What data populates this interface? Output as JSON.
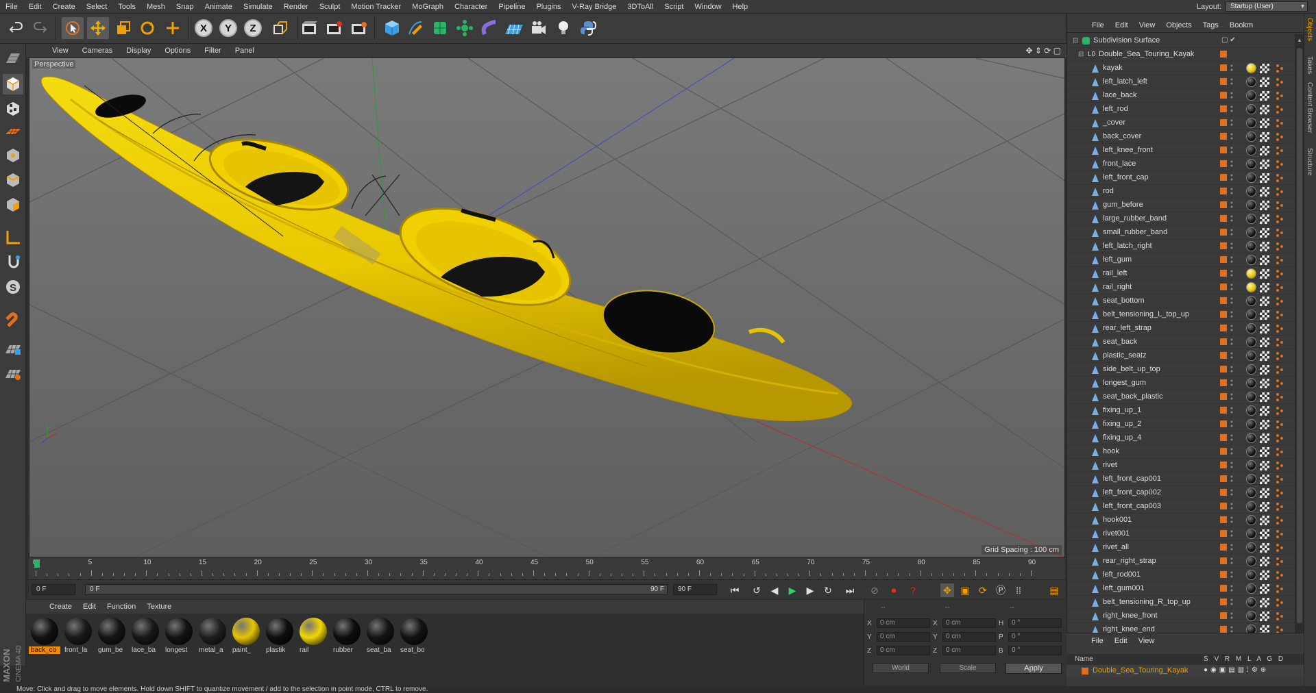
{
  "menubar": {
    "items": [
      "File",
      "Edit",
      "Create",
      "Select",
      "Tools",
      "Mesh",
      "Snap",
      "Animate",
      "Simulate",
      "Render",
      "Sculpt",
      "Motion Tracker",
      "MoGraph",
      "Character",
      "Pipeline",
      "Plugins",
      "V-Ray Bridge",
      "3DToAll",
      "Script",
      "Window",
      "Help"
    ],
    "layout_label": "Layout:",
    "layout_value": "Startup (User)"
  },
  "toolbar": {
    "axis_x": "X",
    "axis_y": "Y",
    "axis_z": "Z",
    "icons": [
      "undo-icon",
      "redo-icon",
      "select-icon",
      "move-icon",
      "scale-icon",
      "rotate-icon",
      "add-icon",
      "x-axis-icon",
      "y-axis-icon",
      "z-axis-icon",
      "coordinate-system-icon",
      "render-view-icon",
      "render-picture-viewer-icon",
      "render-settings-icon",
      "cube-icon",
      "pen-icon",
      "subdivision-icon",
      "array-icon",
      "deformer-icon",
      "floor-icon",
      "camera-icon",
      "light-icon",
      "python-icon"
    ]
  },
  "viewport": {
    "menu": [
      "View",
      "Cameras",
      "Display",
      "Options",
      "Filter",
      "Panel"
    ],
    "label": "Perspective",
    "grid_spacing": "Grid Spacing : 100 cm",
    "background": "#6f6f6f",
    "kayak_color": "#f5d000"
  },
  "timeline": {
    "ticks": [
      "0",
      "5",
      "10",
      "15",
      "20",
      "25",
      "30",
      "35",
      "40",
      "45",
      "50",
      "55",
      "60",
      "65",
      "70",
      "75",
      "80",
      "85",
      "90"
    ],
    "current_frame": "0 F"
  },
  "transport": {
    "start_field": "0 F",
    "range_start": "0 F",
    "range_end": "90 F",
    "end_field": "90 F"
  },
  "materials": {
    "menu": [
      "Create",
      "Edit",
      "Function",
      "Texture"
    ],
    "items": [
      {
        "name": "back_co",
        "color": "#111111",
        "selected": true
      },
      {
        "name": "front_la",
        "color": "#1a1a1a",
        "selected": false
      },
      {
        "name": "gum_be",
        "color": "#151515",
        "selected": false
      },
      {
        "name": "lace_ba",
        "color": "#181818",
        "selected": false
      },
      {
        "name": "longest",
        "color": "#131313",
        "selected": false
      },
      {
        "name": "metal_a",
        "color": "#202020",
        "selected": false
      },
      {
        "name": "paint_",
        "color": "#e6c400",
        "selected": false
      },
      {
        "name": "plastik",
        "color": "#0e0e0e",
        "selected": false
      },
      {
        "name": "rail",
        "color": "#f2d800",
        "selected": false
      },
      {
        "name": "rubber",
        "color": "#0d0d0d",
        "selected": false
      },
      {
        "name": "seat_ba",
        "color": "#141414",
        "selected": false
      },
      {
        "name": "seat_bo",
        "color": "#121212",
        "selected": false
      }
    ],
    "brand": "MAXON CINEMA 4D"
  },
  "coords": {
    "header": [
      "--",
      "--",
      "--"
    ],
    "rows": [
      {
        "a": "X",
        "av": "0 cm",
        "b": "X",
        "bv": "0 cm",
        "c": "H",
        "cv": "0 °"
      },
      {
        "a": "Y",
        "av": "0 cm",
        "b": "Y",
        "bv": "0 cm",
        "c": "P",
        "cv": "0 °"
      },
      {
        "a": "Z",
        "av": "0 cm",
        "b": "Z",
        "bv": "0 cm",
        "c": "B",
        "cv": "0 °"
      }
    ],
    "world": "World",
    "scale": "Scale",
    "apply": "Apply"
  },
  "status": "Move: Click and drag to move elements. Hold down SHIFT to quantize movement / add to the selection in point mode, CTRL to remove.",
  "objects": {
    "menu": [
      "File",
      "Edit",
      "View",
      "Objects",
      "Tags",
      "Bookm"
    ],
    "root": "Subdivision Surface",
    "group": "Double_Sea_Touring_Kayak",
    "items": [
      {
        "name": "kayak",
        "tag": "yellow"
      },
      {
        "name": "left_latch_left",
        "tag": "black"
      },
      {
        "name": "lace_back",
        "tag": "black"
      },
      {
        "name": "left_rod",
        "tag": "black"
      },
      {
        "name": "_cover",
        "tag": "black"
      },
      {
        "name": "back_cover",
        "tag": "black"
      },
      {
        "name": "left_knee_front",
        "tag": "black"
      },
      {
        "name": "front_lace",
        "tag": "black"
      },
      {
        "name": "left_front_cap",
        "tag": "black"
      },
      {
        "name": "rod",
        "tag": "black"
      },
      {
        "name": "gum_before",
        "tag": "black"
      },
      {
        "name": "large_rubber_band",
        "tag": "black"
      },
      {
        "name": "small_rubber_band",
        "tag": "black"
      },
      {
        "name": "left_latch_right",
        "tag": "black"
      },
      {
        "name": "left_gum",
        "tag": "black"
      },
      {
        "name": "rail_left",
        "tag": "yellow"
      },
      {
        "name": "rail_right",
        "tag": "yellow"
      },
      {
        "name": "seat_bottom",
        "tag": "black"
      },
      {
        "name": "belt_tensioning_L_top_up",
        "tag": "black"
      },
      {
        "name": "rear_left_strap",
        "tag": "black"
      },
      {
        "name": "seat_back",
        "tag": "black"
      },
      {
        "name": "plastic_seatz",
        "tag": "black"
      },
      {
        "name": "side_belt_up_top",
        "tag": "black"
      },
      {
        "name": "longest_gum",
        "tag": "black"
      },
      {
        "name": "seat_back_plastic",
        "tag": "black"
      },
      {
        "name": "fixing_up_1",
        "tag": "black"
      },
      {
        "name": "fixing_up_2",
        "tag": "black"
      },
      {
        "name": "fixing_up_4",
        "tag": "black"
      },
      {
        "name": "hook",
        "tag": "black"
      },
      {
        "name": "rivet",
        "tag": "black"
      },
      {
        "name": "left_front_cap001",
        "tag": "black"
      },
      {
        "name": "left_front_cap002",
        "tag": "black"
      },
      {
        "name": "left_front_cap003",
        "tag": "black"
      },
      {
        "name": "hook001",
        "tag": "black"
      },
      {
        "name": "rivet001",
        "tag": "black"
      },
      {
        "name": "rivet_all",
        "tag": "black"
      },
      {
        "name": "rear_right_strap",
        "tag": "black"
      },
      {
        "name": "left_rod001",
        "tag": "black"
      },
      {
        "name": "left_gum001",
        "tag": "black"
      },
      {
        "name": "belt_tensioning_R_top_up",
        "tag": "black"
      },
      {
        "name": "right_knee_front",
        "tag": "black"
      },
      {
        "name": "right_knee_end",
        "tag": "black"
      }
    ]
  },
  "side_tabs": [
    "Objects",
    "Takes",
    "Content Browser",
    "Structure"
  ],
  "layers": {
    "menu": [
      "File",
      "Edit",
      "View"
    ],
    "header_name": "Name",
    "header_cols": "S V R M L A G D",
    "row": "Double_Sea_Touring_Kayak"
  }
}
